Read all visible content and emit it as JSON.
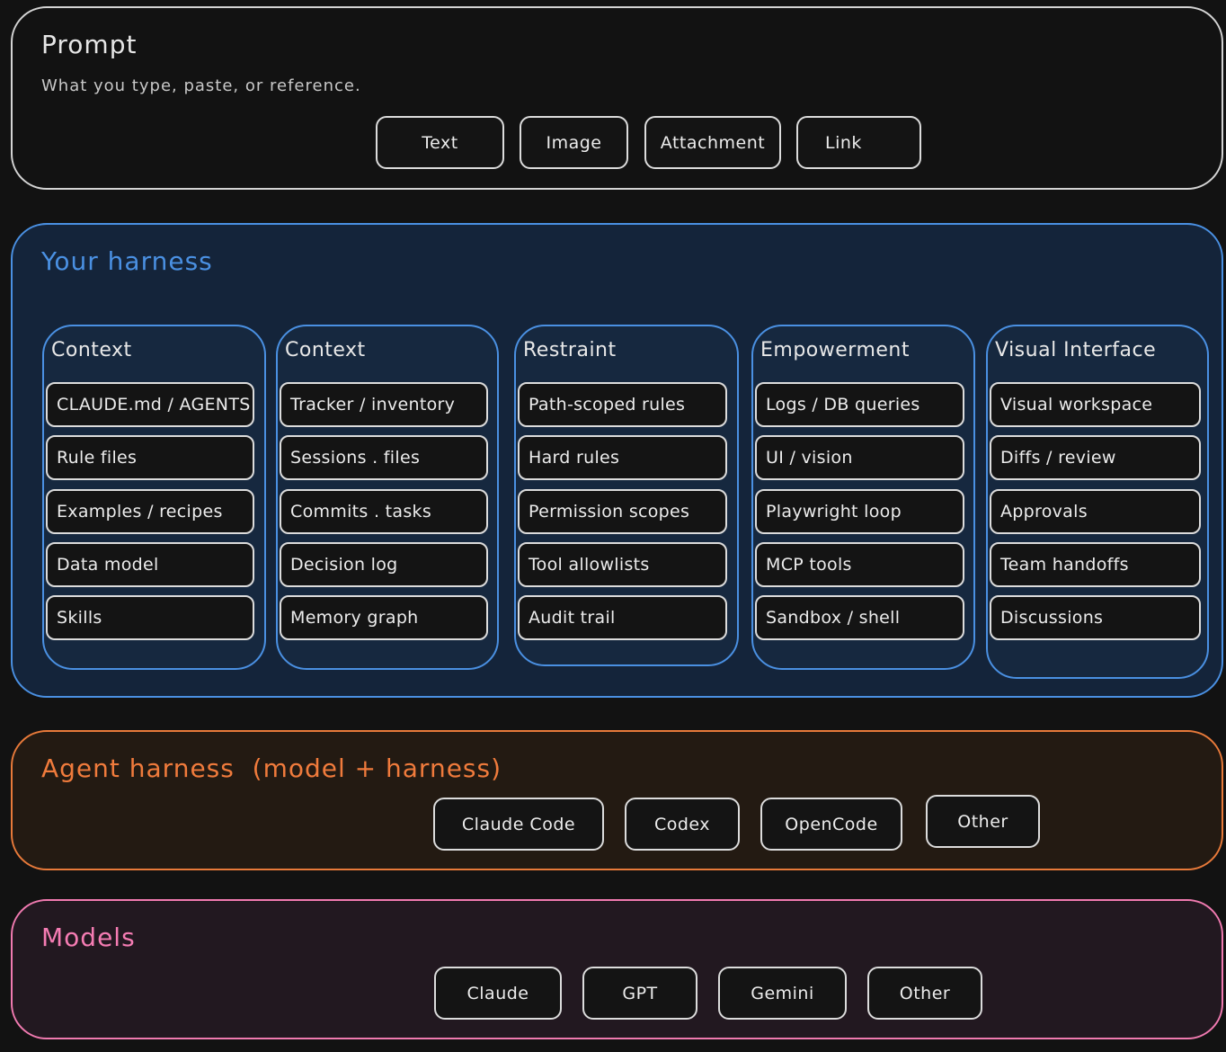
{
  "prompt": {
    "title": "Prompt",
    "subtitle": "What you type, paste, or reference.",
    "chips": [
      "Text",
      "Image",
      "Attachment",
      "Link"
    ]
  },
  "harness": {
    "title": "Your harness",
    "groups": [
      {
        "title": "Context",
        "items": [
          "CLAUDE.md / AGENTS",
          "Rule files",
          "Examples / recipes",
          "Data model",
          "Skills"
        ]
      },
      {
        "title": "Context",
        "items": [
          "Tracker / inventory",
          "Sessions . files",
          "Commits . tasks",
          "Decision log",
          "Memory graph"
        ]
      },
      {
        "title": "Restraint",
        "items": [
          "Path-scoped rules",
          "Hard rules",
          "Permission scopes",
          "Tool allowlists",
          "Audit trail"
        ]
      },
      {
        "title": "Empowerment",
        "items": [
          "Logs / DB queries",
          "UI / vision",
          "Playwright loop",
          "MCP tools",
          "Sandbox / shell"
        ]
      },
      {
        "title": "Visual Interface",
        "items": [
          "Visual workspace",
          "Diffs / review",
          "Approvals",
          "Team handoffs",
          "Discussions"
        ]
      }
    ]
  },
  "agent": {
    "title": "Agent harness  (model + harness)",
    "chips": [
      "Claude Code",
      "Codex",
      "OpenCode",
      "Other"
    ]
  },
  "models": {
    "title": "Models",
    "chips": [
      "Claude",
      "GPT",
      "Gemini",
      "Other"
    ]
  },
  "colors": {
    "prompt_border": "#d4d4d4",
    "harness_accent": "#4a90e2",
    "agent_accent": "#f07b3c",
    "models_accent": "#f57cb3"
  }
}
